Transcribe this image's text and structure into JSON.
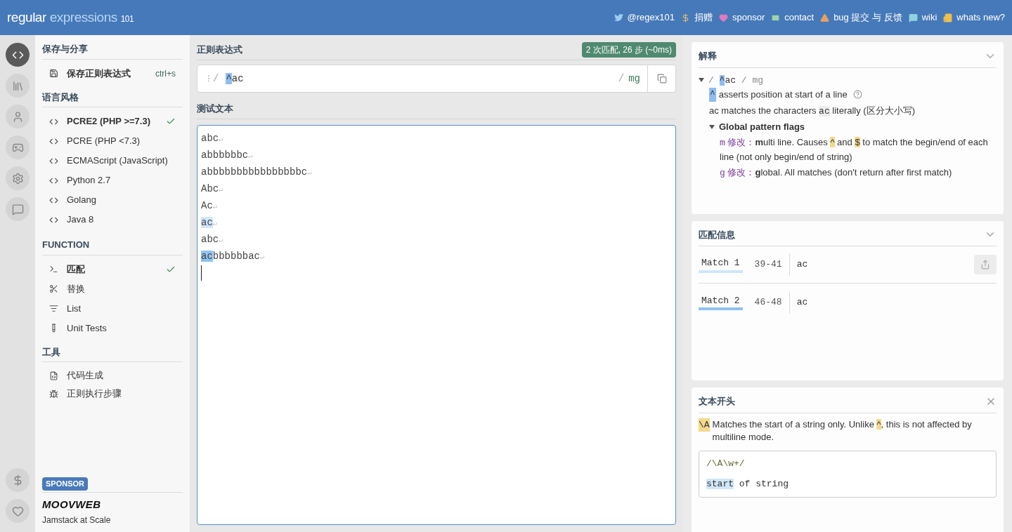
{
  "header": {
    "brand": {
      "word1": "regular",
      "word2": "expressions",
      "version": "101"
    },
    "links": [
      {
        "kind": "twitter",
        "label": "@regex101",
        "color": "#9fcdf2"
      },
      {
        "kind": "dollar",
        "label": "捐赠",
        "color": "#e8c36b"
      },
      {
        "kind": "heart",
        "label": "sponsor",
        "color": "#e07bbf"
      },
      {
        "kind": "mail",
        "label": "contact",
        "color": "#9ed3a8"
      },
      {
        "kind": "warning",
        "label": "bug 提交 与 反馈",
        "color": "#e8a060"
      },
      {
        "kind": "help",
        "label": "wiki",
        "color": "#8fd3df"
      },
      {
        "kind": "news",
        "label": "whats new?",
        "color": "#f0c04a"
      }
    ]
  },
  "rail": {
    "top": [
      {
        "kind": "code",
        "selected": true
      },
      {
        "kind": "library",
        "selected": false
      },
      {
        "kind": "user",
        "selected": false
      },
      {
        "kind": "game",
        "selected": false
      },
      {
        "kind": "settings",
        "selected": false
      },
      {
        "kind": "chat",
        "selected": false
      }
    ],
    "bottom": [
      {
        "kind": "dollar",
        "selected": false
      },
      {
        "kind": "heart",
        "selected": false
      }
    ]
  },
  "sidebar": {
    "save": {
      "title": "保存与分享",
      "item": {
        "label": "保存正则表达式",
        "shortcut": "ctrl+s"
      }
    },
    "flavor": {
      "title": "语言风格",
      "items": [
        {
          "label": "PCRE2 (PHP >=7.3)",
          "selected": true
        },
        {
          "label": "PCRE (PHP <7.3)",
          "selected": false
        },
        {
          "label": "ECMAScript (JavaScript)",
          "selected": false
        },
        {
          "label": "Python 2.7",
          "selected": false
        },
        {
          "label": "Golang",
          "selected": false
        },
        {
          "label": "Java 8",
          "selected": false
        }
      ]
    },
    "function": {
      "title": "FUNCTION",
      "items": [
        {
          "kind": "match",
          "label": "匹配",
          "selected": true
        },
        {
          "kind": "replace",
          "label": "替换",
          "selected": false
        },
        {
          "kind": "list",
          "label": "List",
          "selected": false
        },
        {
          "kind": "tests",
          "label": "Unit Tests",
          "selected": false
        }
      ]
    },
    "tools": {
      "title": "工具",
      "items": [
        {
          "kind": "codegen",
          "label": "代码生成"
        },
        {
          "kind": "debugger",
          "label": "正则执行步骤"
        }
      ]
    },
    "sponsor": {
      "badge": "SPONSOR",
      "logo": "MOOVWEB",
      "tagline": "Jamstack at Scale"
    }
  },
  "regex": {
    "title": "正则表达式",
    "status": "2 次匹配, 26 步 (~0ms)",
    "delimiter": "/",
    "pattern": [
      {
        "text": "^",
        "hl": true
      },
      {
        "text": "ac",
        "hl": false
      }
    ],
    "closing": "/",
    "flags": "mg"
  },
  "test": {
    "title": "测试文本",
    "lines": [
      {
        "segments": [
          {
            "text": "abc"
          }
        ],
        "eol": "↵"
      },
      {
        "segments": [
          {
            "text": "abbbbbbc"
          }
        ],
        "eol": "↵"
      },
      {
        "segments": [
          {
            "text": "abbbbbbbbbbbbbbbbc"
          }
        ],
        "eol": "↵"
      },
      {
        "segments": [
          {
            "text": "Abc"
          }
        ],
        "eol": "↵"
      },
      {
        "segments": [
          {
            "text": "Ac"
          }
        ],
        "eol": "↵"
      },
      {
        "segments": [
          {
            "text": "ac",
            "color": "#cfe6fb"
          }
        ],
        "eol": "↵"
      },
      {
        "segments": [
          {
            "text": "abc"
          }
        ],
        "eol": "↵"
      },
      {
        "segments": [
          {
            "text": "ac",
            "color": "#8fc3f2"
          },
          {
            "text": "bbbbbbac"
          }
        ],
        "eol": "↵"
      }
    ]
  },
  "explanation": {
    "title": "解释",
    "expanded": true,
    "root": {
      "segments": [
        {
          "text": "/ ",
          "kind": "delim"
        },
        {
          "text": "^",
          "kind": "blue"
        },
        {
          "text": "ac",
          "kind": "plain"
        },
        {
          "text": " / mg",
          "kind": "delim"
        }
      ]
    },
    "rows": [
      {
        "kind": "token",
        "token": "^",
        "text": "asserts position at start of a line"
      },
      {
        "kind": "text",
        "segments": [
          {
            "text": "ac",
            "kind": "plain"
          },
          {
            "text": " matches the characters ",
            "kind": "plain"
          },
          {
            "text": "ac",
            "kind": "code"
          },
          {
            "text": " literally (区分大小写)",
            "kind": "plain"
          }
        ]
      },
      {
        "kind": "group",
        "title": "Global pattern flags",
        "expanded": true,
        "children": [
          {
            "flag": "m",
            "prefix": "修改：",
            "segments": [
              {
                "text": "m",
                "kind": "bold"
              },
              {
                "text": "ulti line. Causes ",
                "kind": "plain"
              },
              {
                "text": "^",
                "kind": "yellow"
              },
              {
                "text": " and ",
                "kind": "plain"
              },
              {
                "text": "$",
                "kind": "yellow"
              },
              {
                "text": " to match the begin/end of each line (not only begin/end of string)",
                "kind": "plain"
              }
            ]
          },
          {
            "flag": "g",
            "prefix": "修改：",
            "segments": [
              {
                "text": "g",
                "kind": "bold"
              },
              {
                "text": "lobal. All matches (don't return after first match)",
                "kind": "plain"
              }
            ]
          }
        ]
      }
    ]
  },
  "matches": {
    "title": "匹配信息",
    "items": [
      {
        "label": "Match 1",
        "range": "39-41",
        "value": "ac",
        "color": "#cfe6fb"
      },
      {
        "label": "Match 2",
        "range": "46-48",
        "value": "ac",
        "color": "#8fc3f2"
      }
    ]
  },
  "reference": {
    "title": "文本开头",
    "token": "\\A",
    "description": [
      {
        "text": "Matches the start of a string only. Unlike ",
        "kind": "plain"
      },
      {
        "text": "^",
        "kind": "yellow"
      },
      {
        "text": ", this is not affected by multiline mode.",
        "kind": "plain"
      }
    ],
    "example": {
      "pattern": "/\\A\\w+/",
      "text": [
        {
          "text": "start",
          "hl": true
        },
        {
          "text": " of string",
          "hl": false
        }
      ]
    }
  }
}
